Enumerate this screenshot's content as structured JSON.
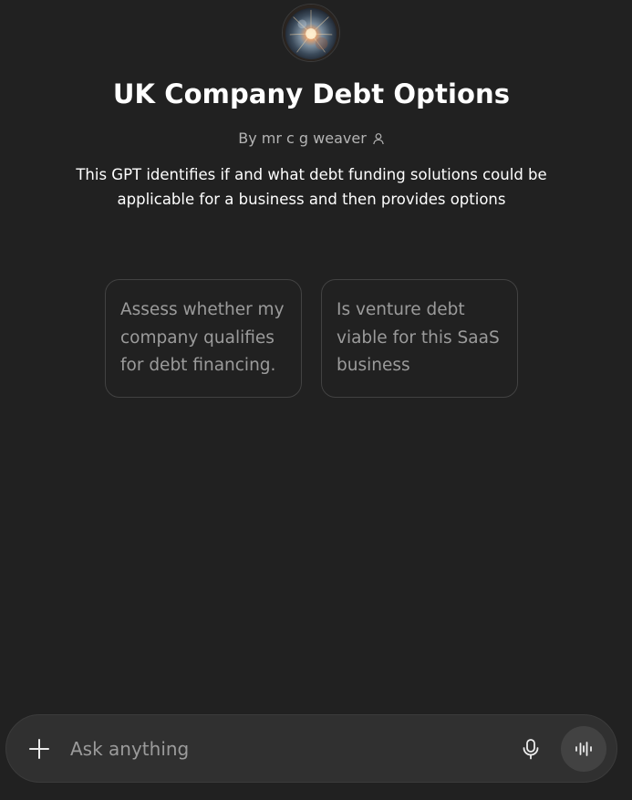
{
  "gpt": {
    "avatar_icon": "orb-avatar-icon",
    "title": "UK Company Debt Options",
    "author": "By mr c g weaver",
    "author_icon": "person-icon",
    "description": "This GPT identifies if and what debt funding solutions could be applicable for a business and then provides options"
  },
  "starters": [
    {
      "text": "Assess whether my company qualifies for debt financing."
    },
    {
      "text": "Is venture debt viable for this SaaS business"
    }
  ],
  "composer": {
    "placeholder": "Ask anything",
    "value": "",
    "plus_icon": "plus-icon",
    "mic_icon": "microphone-icon",
    "voice_icon": "voice-mode-icon"
  },
  "colors": {
    "background": "#212121",
    "composer_bg": "#303030",
    "voice_button_bg": "#424242",
    "card_border": "#424242"
  }
}
